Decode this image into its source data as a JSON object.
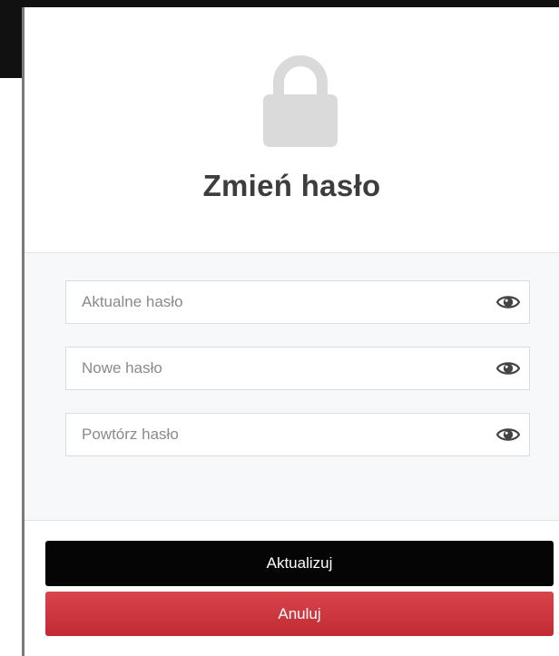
{
  "dialog": {
    "title": "Zmień hasło",
    "lock_icon": "lock-icon"
  },
  "fields": [
    {
      "name": "current-password",
      "placeholder": "Aktualne hasło",
      "value": "",
      "icon": "eye-icon"
    },
    {
      "name": "new-password",
      "placeholder": "Nowe hasło",
      "value": "",
      "icon": "eye-icon"
    },
    {
      "name": "repeat-password",
      "placeholder": "Powtórz hasło",
      "value": "",
      "icon": "eye-icon"
    }
  ],
  "buttons": {
    "update_label": "Aktualizuj",
    "cancel_label": "Anuluj"
  },
  "colors": {
    "update_button": "#050505",
    "cancel_button": "#c9343c",
    "body_background": "#f7f8f9",
    "lock_icon": "#dadada",
    "title": "#3d3d3d"
  }
}
